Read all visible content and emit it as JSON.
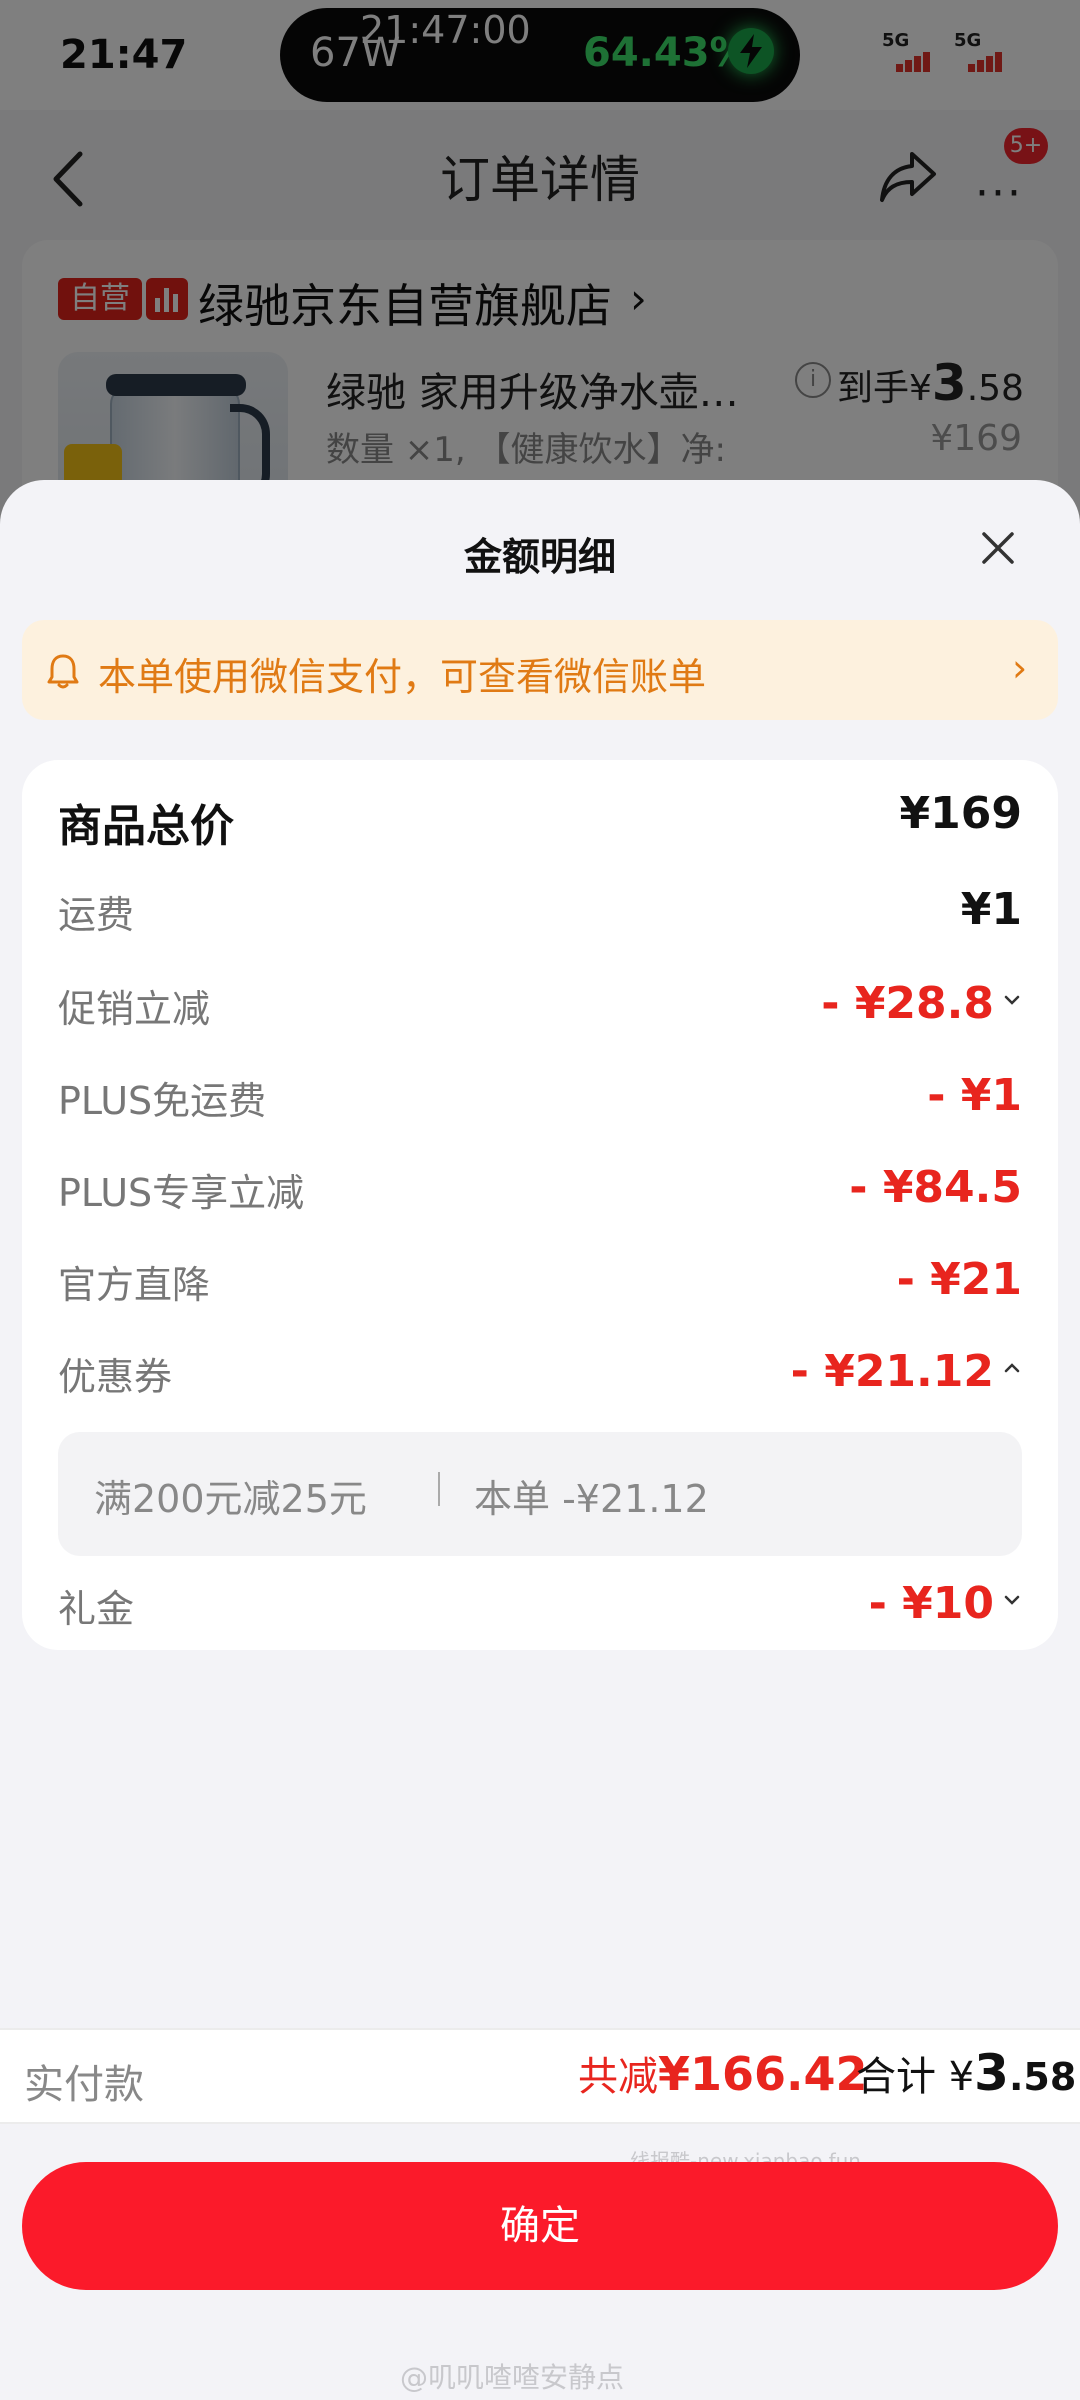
{
  "status_bar": {
    "time": "21:47",
    "island_clock": "21:47:00",
    "charge_watt": "67W",
    "battery_percent": "64.43%",
    "signal_1": "5G",
    "signal_2": "5G"
  },
  "nav": {
    "title": "订单详情",
    "more_badge": "5+"
  },
  "order": {
    "self_operated_tag": "自营",
    "shop_name": "绿驰京东自营旗舰店",
    "shop_arrow": "›",
    "product_title": "绿驰 家用升级净水壶…",
    "product_spec": "数量 ×1, 【健康饮水】净:",
    "arrive_label": "到手¥",
    "arrive_price_int": "3",
    "arrive_price_dec": ".58",
    "original_price": "¥169"
  },
  "sheet": {
    "title": "金额明细",
    "wechat_notice": "本单使用微信支付，可查看微信账单",
    "wechat_arrow": "›",
    "rows": [
      {
        "label": "商品总价",
        "value": "¥169"
      },
      {
        "label": "运费",
        "value": "¥1"
      },
      {
        "label": "促销立减",
        "value": "- ¥28.8"
      },
      {
        "label": "PLUS免运费",
        "value": "- ¥1"
      },
      {
        "label": "PLUS专享立减",
        "value": "- ¥84.5"
      },
      {
        "label": "官方直降",
        "value": "- ¥21"
      },
      {
        "label": "优惠券",
        "value": "- ¥21.12"
      },
      {
        "label": "礼金",
        "value": "- ¥10"
      }
    ],
    "coupon_detail": {
      "rule": "满200元减25元",
      "this_order": "本单 -¥21.12"
    }
  },
  "pay": {
    "label": "实付款",
    "reduce_label": "共减",
    "reduce_value": "¥166.42",
    "total_label": "合计 ¥",
    "total_int": "3",
    "total_dec": ".58"
  },
  "confirm_label": "确定",
  "watermarks": {
    "line": "线报酷-new.xianbao.fun",
    "weibo": "@叽叽喳喳安静点"
  },
  "colors": {
    "accent_red": "#e8251e",
    "button_red": "#fb1a2a",
    "notice_orange": "#e07a14",
    "notice_bg": "#fdf1de",
    "charge_green": "#3de36b"
  },
  "icons": [
    "back-icon",
    "share-icon",
    "more-icon",
    "info-icon",
    "bell-icon",
    "close-icon",
    "chevron-down-icon",
    "chevron-up-icon",
    "lightning-icon"
  ]
}
